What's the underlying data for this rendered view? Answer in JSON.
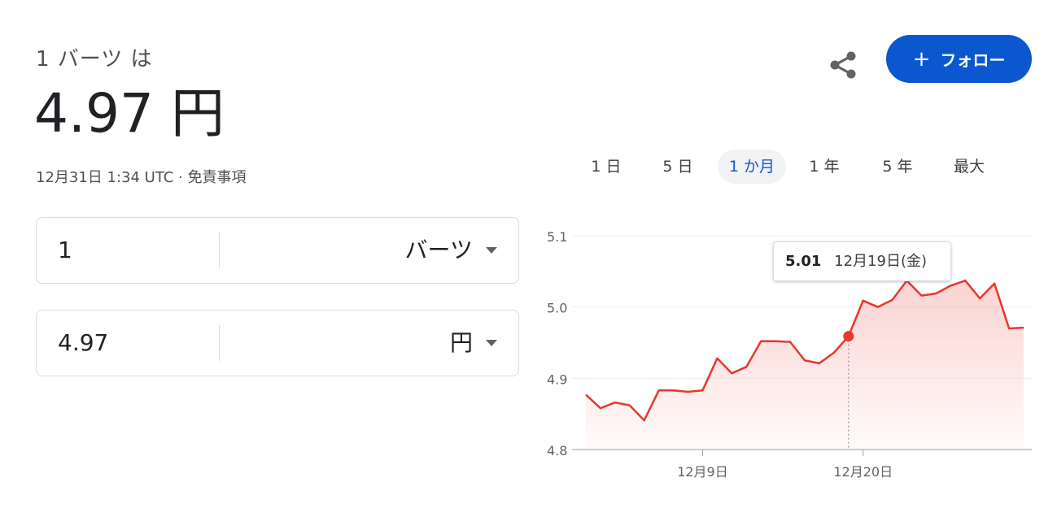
{
  "header": {
    "from_line": "1 バーツ は",
    "rate_value": "4.97",
    "rate_unit": "円",
    "timestamp": "12月31日 1:34 UTC",
    "separator": "·",
    "disclaimer_link": "免責事項"
  },
  "converter": {
    "from": {
      "amount": "1",
      "currency": "バーツ"
    },
    "to": {
      "amount": "4.97",
      "currency": "円"
    }
  },
  "actions": {
    "share_icon": "share-icon",
    "follow_label": "フォロー",
    "follow_plus": "+",
    "follow_color": "#0b57d0"
  },
  "range_tabs": [
    {
      "label": "1 日",
      "active": false
    },
    {
      "label": "5 日",
      "active": false
    },
    {
      "label": "1 か月",
      "active": true
    },
    {
      "label": "1 年",
      "active": false
    },
    {
      "label": "5 年",
      "active": false
    },
    {
      "label": "最大",
      "active": false
    }
  ],
  "tooltip": {
    "value": "5.01",
    "date": "12月19日(金)"
  },
  "chart_data": {
    "type": "area",
    "line_color": "#e8372c",
    "ylim": [
      4.8,
      5.1
    ],
    "y_ticks": [
      "4.8",
      "4.9",
      "5.0",
      "5.1"
    ],
    "x_ticks": [
      {
        "label": "12月9日",
        "index": 9
      },
      {
        "label": "12月20日",
        "index": 20
      }
    ],
    "grid": true,
    "highlight_index": 19,
    "x": [
      1,
      2,
      3,
      4,
      5,
      6,
      7,
      8,
      9,
      10,
      11,
      12,
      13,
      14,
      15,
      16,
      17,
      18,
      19,
      20,
      21,
      22,
      23,
      24,
      25,
      26,
      27,
      28,
      29,
      30,
      31
    ],
    "values": [
      4.877,
      4.858,
      4.866,
      4.862,
      4.841,
      4.883,
      4.883,
      4.881,
      4.883,
      4.928,
      4.907,
      4.916,
      4.952,
      4.952,
      4.951,
      4.925,
      4.921,
      4.936,
      4.959,
      5.009,
      5.0,
      5.01,
      5.037,
      5.016,
      5.019,
      5.03,
      5.037,
      5.012,
      5.033,
      4.97,
      4.971
    ]
  }
}
